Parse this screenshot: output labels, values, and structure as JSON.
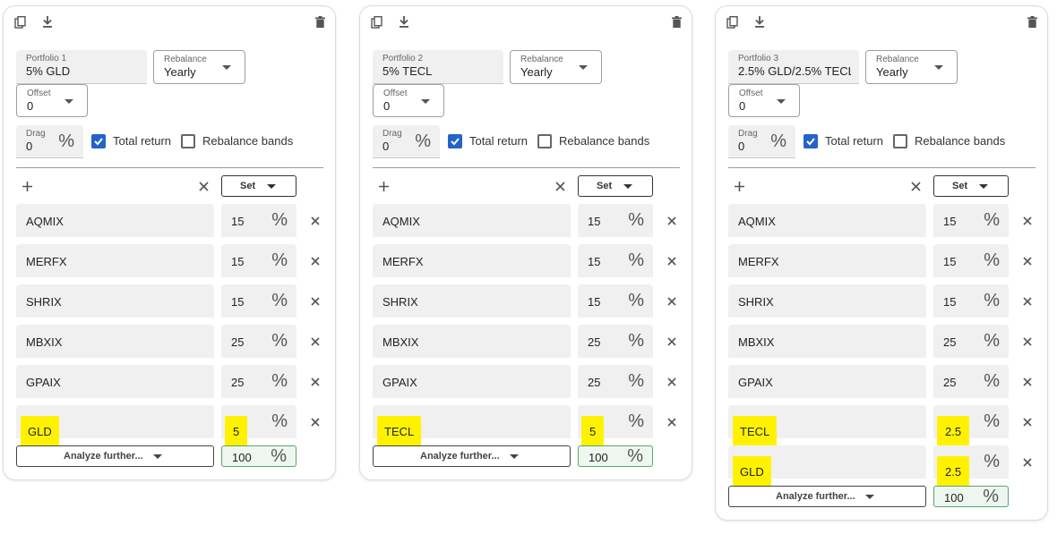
{
  "labels": {
    "rebalance": "Rebalance",
    "offset": "Offset",
    "drag": "Drag",
    "total_return": "Total return",
    "rebalance_bands": "Rebalance bands",
    "set": "Set",
    "analyze": "Analyze further...",
    "pct": "%"
  },
  "icons": {
    "copy": "copy-icon",
    "download": "download-icon",
    "delete": "trash-icon",
    "add": "plus-icon",
    "clear": "close-icon",
    "dropdown": "caret-down-icon"
  },
  "colors": {
    "highlight": "#fff200",
    "checkbox": "#2463c9",
    "total_border": "#5aa56a"
  },
  "portfolios": [
    {
      "label": "Portfolio 1",
      "name": "5% GLD",
      "rebalance": "Yearly",
      "offset": "0",
      "drag": "0",
      "total_return": true,
      "rebalance_bands": false,
      "holdings": [
        {
          "ticker": "AQMIX",
          "pct": "15"
        },
        {
          "ticker": "MERFX",
          "pct": "15"
        },
        {
          "ticker": "SHRIX",
          "pct": "15"
        },
        {
          "ticker": "MBXIX",
          "pct": "25"
        },
        {
          "ticker": "GPAIX",
          "pct": "25"
        },
        {
          "ticker": "GLD",
          "pct": "5"
        }
      ],
      "total": "100"
    },
    {
      "label": "Portfolio 2",
      "name": "5% TECL",
      "rebalance": "Yearly",
      "offset": "0",
      "drag": "0",
      "total_return": true,
      "rebalance_bands": false,
      "holdings": [
        {
          "ticker": "AQMIX",
          "pct": "15"
        },
        {
          "ticker": "MERFX",
          "pct": "15"
        },
        {
          "ticker": "SHRIX",
          "pct": "15"
        },
        {
          "ticker": "MBXIX",
          "pct": "25"
        },
        {
          "ticker": "GPAIX",
          "pct": "25"
        },
        {
          "ticker": "TECL",
          "pct": "5"
        }
      ],
      "total": "100"
    },
    {
      "label": "Portfolio 3",
      "name": "2.5% GLD/2.5% TECL",
      "rebalance": "Yearly",
      "offset": "0",
      "drag": "0",
      "total_return": true,
      "rebalance_bands": false,
      "holdings": [
        {
          "ticker": "AQMIX",
          "pct": "15"
        },
        {
          "ticker": "MERFX",
          "pct": "15"
        },
        {
          "ticker": "SHRIX",
          "pct": "15"
        },
        {
          "ticker": "MBXIX",
          "pct": "25"
        },
        {
          "ticker": "GPAIX",
          "pct": "25"
        },
        {
          "ticker": "TECL",
          "pct": "2.5"
        },
        {
          "ticker": "GLD",
          "pct": "2.5"
        }
      ],
      "total": "100"
    }
  ]
}
